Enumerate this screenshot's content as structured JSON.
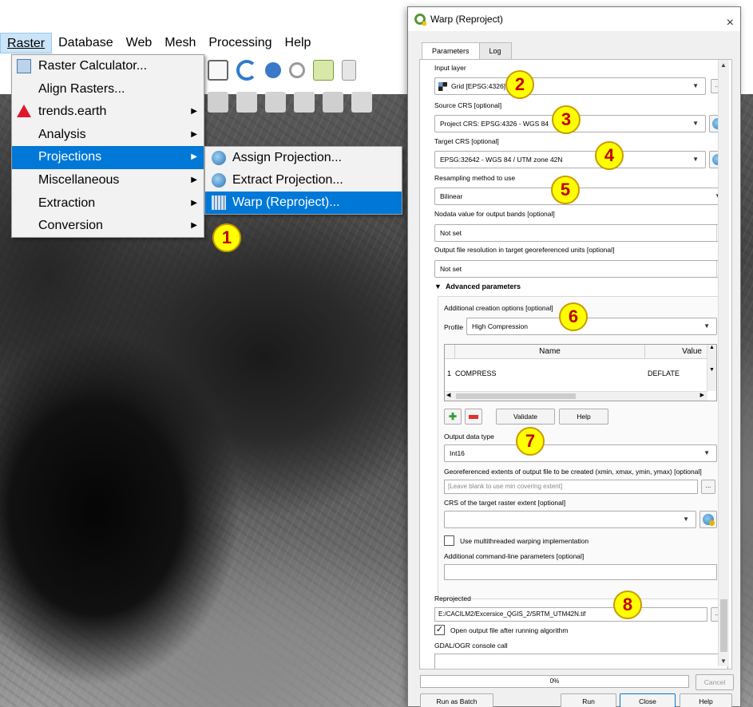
{
  "menubar": {
    "items": [
      "Raster",
      "Database",
      "Web",
      "Mesh",
      "Processing",
      "Help"
    ]
  },
  "raster_menu": {
    "items": [
      {
        "label": "Raster Calculator...",
        "submenu": false
      },
      {
        "label": "Align Rasters...",
        "submenu": false
      },
      {
        "label": "trends.earth",
        "submenu": true
      },
      {
        "label": "Analysis",
        "submenu": true
      },
      {
        "label": "Projections",
        "submenu": true
      },
      {
        "label": "Miscellaneous",
        "submenu": true
      },
      {
        "label": "Extraction",
        "submenu": true
      },
      {
        "label": "Conversion",
        "submenu": true
      }
    ]
  },
  "projections_submenu": {
    "items": [
      "Assign Projection...",
      "Extract Projection...",
      "Warp (Reproject)..."
    ]
  },
  "dialog": {
    "title": "Warp (Reproject)",
    "close": "×",
    "tabs": [
      "Parameters",
      "Log"
    ],
    "input_layer_label": "Input layer",
    "input_layer_value": "Grid [EPSG:4326]",
    "source_crs_label": "Source CRS [optional]",
    "source_crs_value": "Project CRS: EPSG:4326 - WGS 84",
    "target_crs_label": "Target CRS [optional]",
    "target_crs_value": "EPSG:32642 - WGS 84 / UTM zone 42N",
    "resampling_label": "Resampling method to use",
    "resampling_value": "Bilinear",
    "nodata_label": "Nodata value for output bands [optional]",
    "nodata_value": "Not set",
    "resolution_label": "Output file resolution in target georeferenced units [optional]",
    "resolution_value": "Not set",
    "advanced_label": "Advanced parameters",
    "creation_options_label": "Additional creation options [optional]",
    "profile_label": "Profile",
    "profile_value": "High Compression",
    "table_headers": [
      "Name",
      "Value"
    ],
    "table_rows": [
      {
        "index": "1",
        "name": "COMPRESS",
        "value": "DEFLATE"
      }
    ],
    "validate_label": "Validate",
    "help_small_label": "Help",
    "output_type_label": "Output data type",
    "output_type_value": "Int16",
    "extent_label": "Georeferenced extents of output file to be created (xmin, xmax, ymin, ymax) [optional]",
    "extent_placeholder": "[Leave blank to use min covering extent]",
    "extent_crs_label": "CRS of the target raster extent [optional]",
    "multithread_label": "Use multithreaded warping implementation",
    "cmdline_label": "Additional command-line parameters [optional]",
    "reprojected_label": "Reprojected",
    "reprojected_value": "E:/CACILM2/Excersice_QGIS_2/SRTM_UTM42N.tif",
    "open_output_label": "Open output file after running algorithm",
    "console_label": "GDAL/OGR console call",
    "progress_text": "0%",
    "progress": 0,
    "cancel_label": "Cancel",
    "batch_label": "Run as Batch Process...",
    "run_label": "Run",
    "close_label": "Close",
    "help_label": "Help"
  },
  "callouts": [
    "1",
    "2",
    "3",
    "4",
    "5",
    "6",
    "7",
    "8"
  ],
  "colors": {
    "menu_highlight": "#0078d7",
    "badge_fill": "#ffff00",
    "badge_text": "#c00000",
    "qgis_green": "#589632"
  }
}
